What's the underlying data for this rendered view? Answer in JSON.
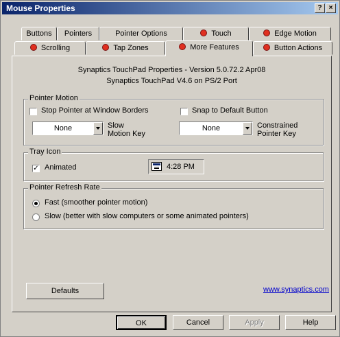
{
  "window": {
    "title": "Mouse Properties",
    "help_glyph": "?",
    "close_glyph": "×"
  },
  "tabs_row1": [
    {
      "label": "Buttons",
      "icon": ""
    },
    {
      "label": "Pointers",
      "icon": ""
    },
    {
      "label": "Pointer Options",
      "icon": ""
    },
    {
      "label": "Touch",
      "icon": "synaptics-touch-icon"
    },
    {
      "label": "Edge Motion",
      "icon": "synaptics-touch-icon"
    }
  ],
  "tabs_row2": [
    {
      "label": "Scrolling",
      "icon": "synaptics-touch-icon"
    },
    {
      "label": "Tap Zones",
      "icon": "synaptics-touch-icon"
    },
    {
      "label": "More Features",
      "icon": "synaptics-touch-icon",
      "active": true
    },
    {
      "label": "Button Actions",
      "icon": "synaptics-touch-icon"
    }
  ],
  "info": {
    "line1": "Synaptics TouchPad Properties - Version 5.0.72.2 Apr08",
    "line2": "Synaptics TouchPad V4.6 on PS/2 Port"
  },
  "pointer_motion": {
    "label": "Pointer Motion",
    "stop_pointer_label": "Stop Pointer at Window Borders",
    "stop_pointer_checked": false,
    "snap_default_label": "Snap to Default Button",
    "snap_default_checked": false,
    "slow_motion_value": "None",
    "slow_motion_label_1": "Slow",
    "slow_motion_label_2": "Motion Key",
    "constrained_value": "None",
    "constrained_label_1": "Constrained",
    "constrained_label_2": "Pointer Key"
  },
  "tray_icon": {
    "label": "Tray Icon",
    "animated_label": "Animated",
    "animated_checked": true,
    "check_glyph": "✓",
    "clock_time": "4:28 PM"
  },
  "refresh_rate": {
    "label": "Pointer Refresh Rate",
    "fast_label": "Fast (smoother pointer motion)",
    "slow_label": "Slow (better with slow computers or some animated pointers)",
    "selected": "fast"
  },
  "panel_footer": {
    "defaults_label": "Defaults",
    "link_text": "www.synaptics.com"
  },
  "dialog_buttons": {
    "ok": "OK",
    "cancel": "Cancel",
    "apply": "Apply",
    "help": "Help"
  }
}
